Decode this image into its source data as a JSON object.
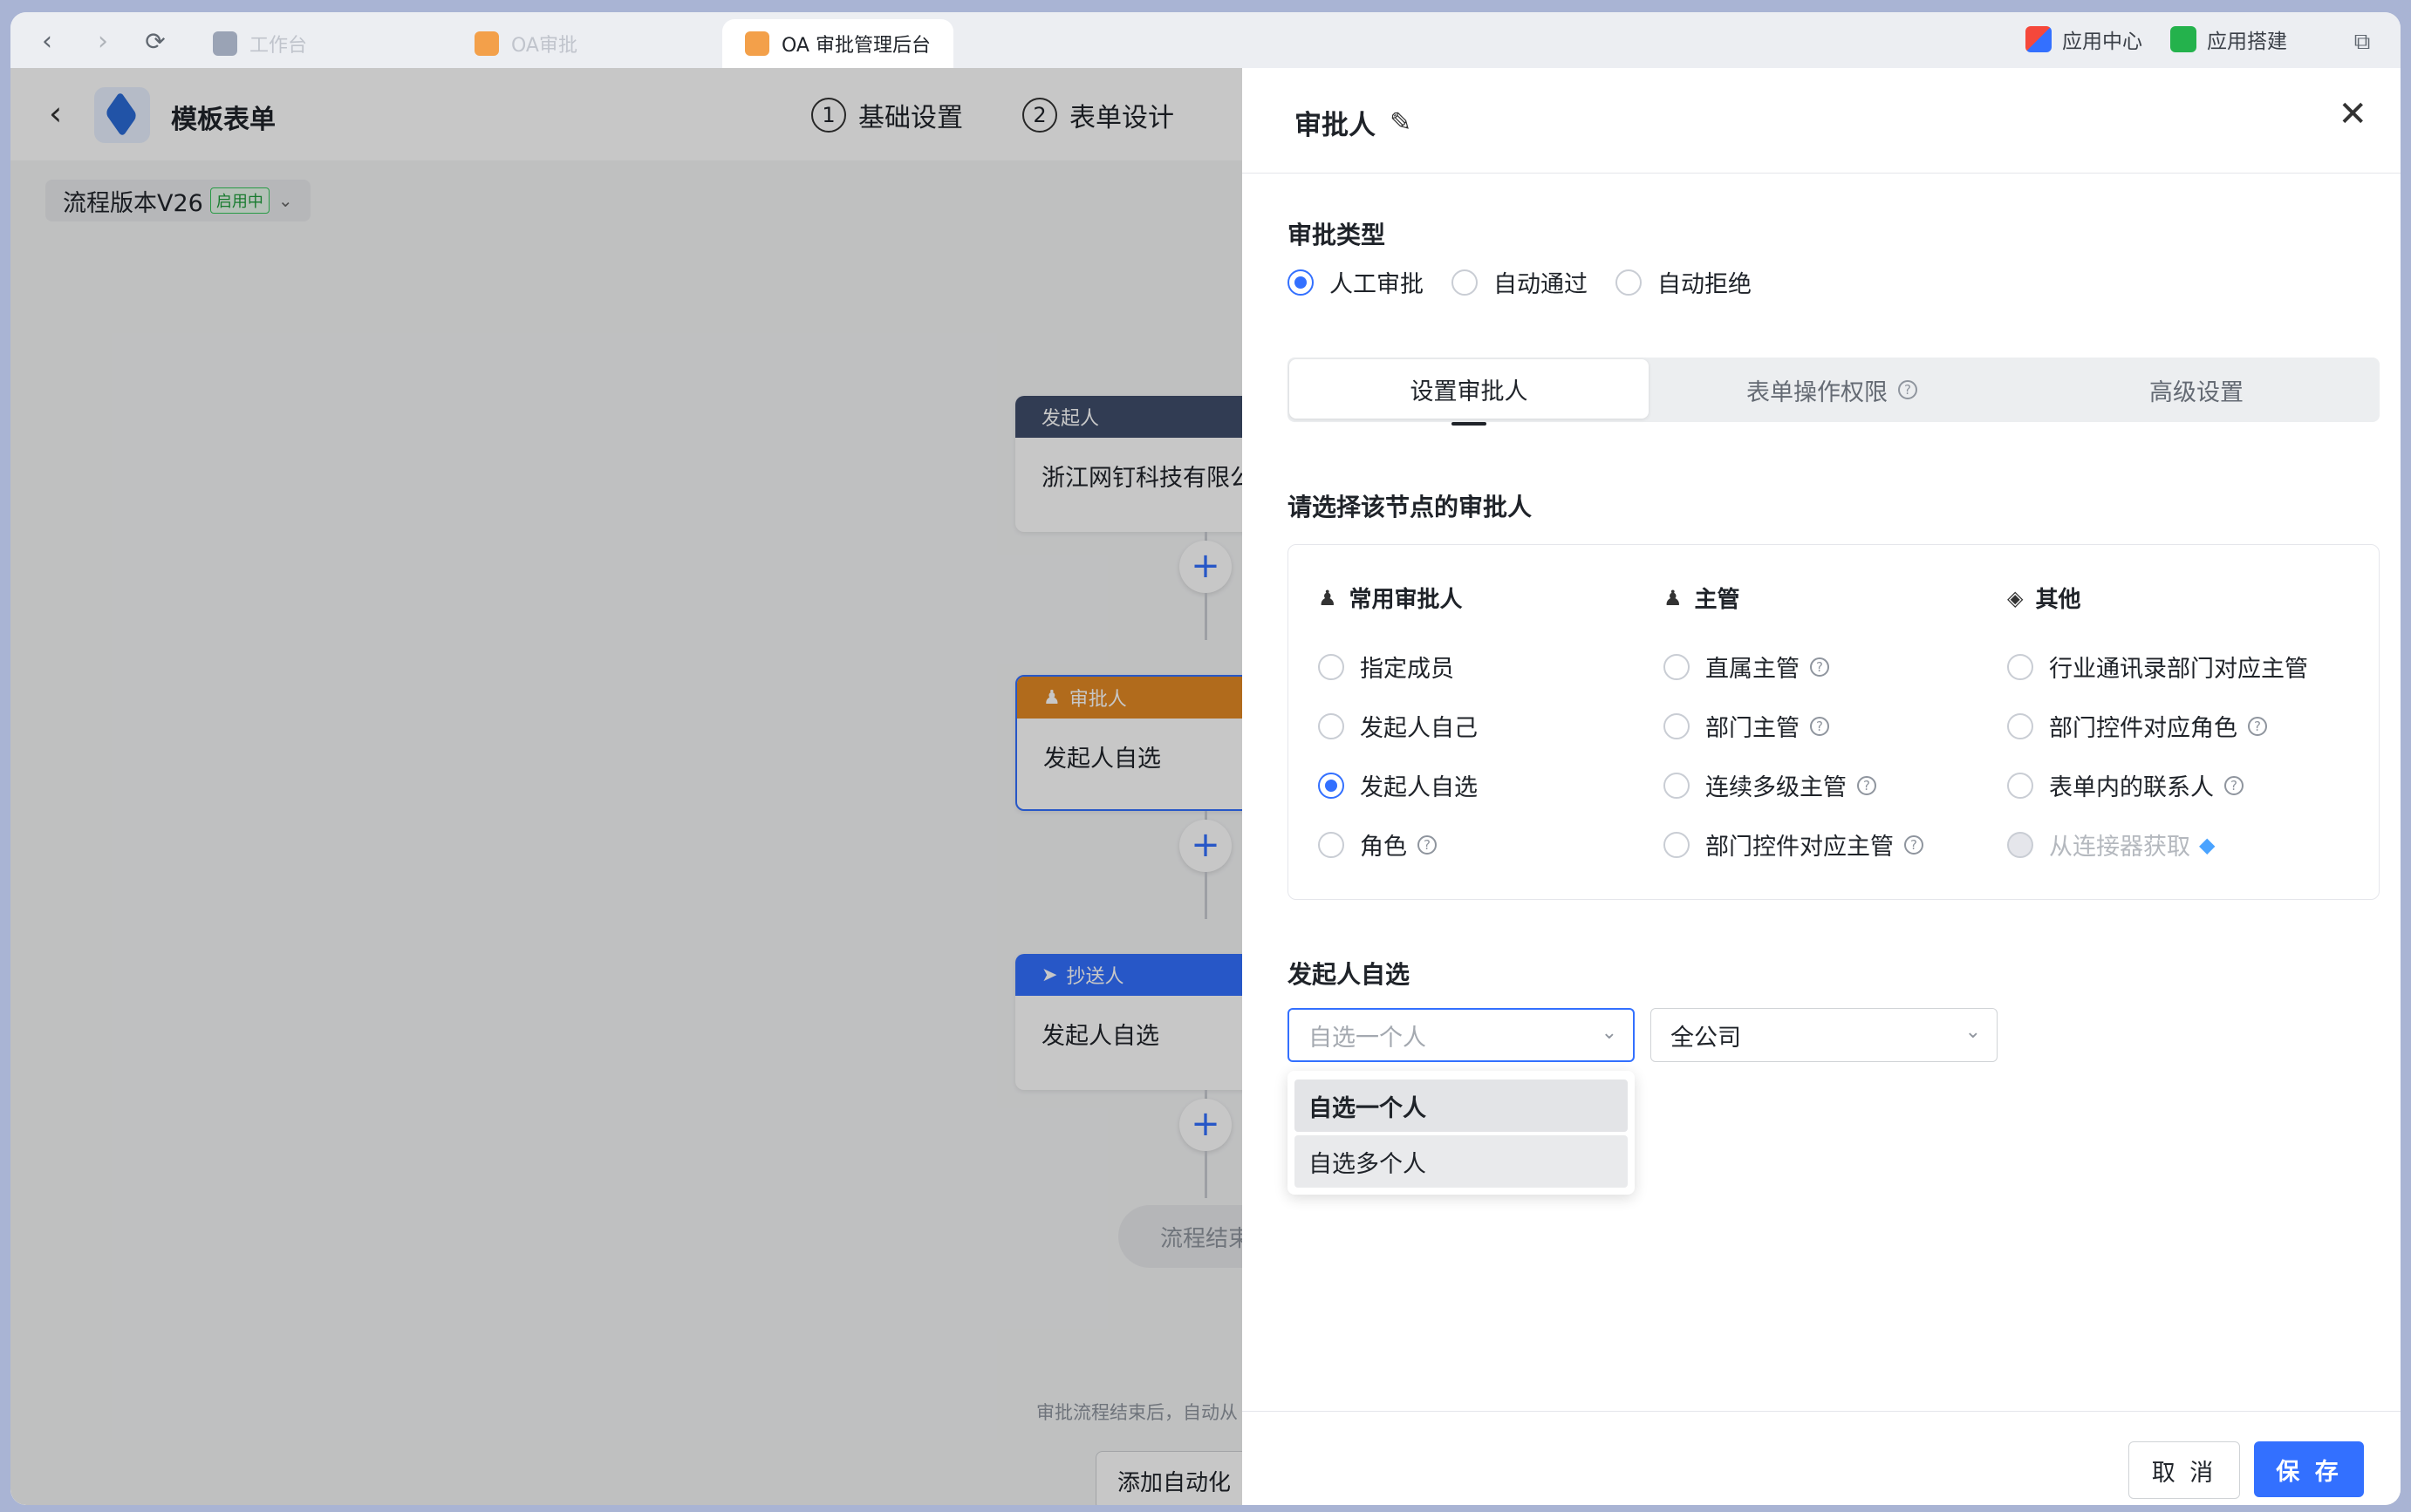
{
  "browser": {
    "tabs": [
      {
        "label": "工作台",
        "active": false
      },
      {
        "label": "OA审批",
        "active": false
      },
      {
        "label": "OA 审批管理后台",
        "active": true
      }
    ],
    "right": [
      {
        "label": "应用中心"
      },
      {
        "label": "应用搭建"
      }
    ]
  },
  "app": {
    "title": "模板表单",
    "steps": [
      {
        "num": "1",
        "label": "基础设置"
      },
      {
        "num": "2",
        "label": "表单设计"
      }
    ],
    "version_label": "流程版本V26",
    "version_badge": "启用中"
  },
  "flow": {
    "nodes": [
      {
        "header": "发起人",
        "body": "浙江网钉科技有限公",
        "color": "#3f4d6b"
      },
      {
        "header": "审批人",
        "body": "发起人自选",
        "color": "#e38a24"
      },
      {
        "header": "抄送人",
        "body": "发起人自选",
        "color": "#3370ff"
      }
    ],
    "end_label": "流程结束",
    "hint": "审批流程结束后，自动从",
    "auto_button": "添加自动化"
  },
  "drawer": {
    "title": "审批人",
    "approval_type_title": "审批类型",
    "approval_types": [
      {
        "label": "人工审批",
        "checked": true
      },
      {
        "label": "自动通过",
        "checked": false
      },
      {
        "label": "自动拒绝",
        "checked": false
      }
    ],
    "tabs": [
      {
        "label": "设置审批人",
        "active": true
      },
      {
        "label": "表单操作权限",
        "active": false
      },
      {
        "label": "高级设置",
        "active": false
      }
    ],
    "select_title": "请选择该节点的审批人",
    "columns": [
      {
        "title": "常用审批人",
        "options": [
          {
            "label": "指定成员",
            "checked": false
          },
          {
            "label": "发起人自己",
            "checked": false
          },
          {
            "label": "发起人自选",
            "checked": true
          },
          {
            "label": "角色",
            "checked": false
          }
        ]
      },
      {
        "title": "主管",
        "options": [
          {
            "label": "直属主管",
            "checked": false
          },
          {
            "label": "部门主管",
            "checked": false
          },
          {
            "label": "连续多级主管",
            "checked": false
          },
          {
            "label": "部门控件对应主管",
            "checked": false
          }
        ]
      },
      {
        "title": "其他",
        "options": [
          {
            "label": "行业通讯录部门对应主管",
            "checked": false
          },
          {
            "label": "部门控件对应角色",
            "checked": false
          },
          {
            "label": "表单内的联系人",
            "checked": false
          },
          {
            "label": "从连接器获取",
            "checked": false,
            "disabled": true
          }
        ]
      }
    ],
    "self_select_title": "发起人自选",
    "self_select_value": "自选一个人",
    "scope_value": "全公司",
    "dropdown_options": [
      "自选一个人",
      "自选多个人"
    ],
    "cancel_label": "取 消",
    "save_label": "保 存"
  }
}
